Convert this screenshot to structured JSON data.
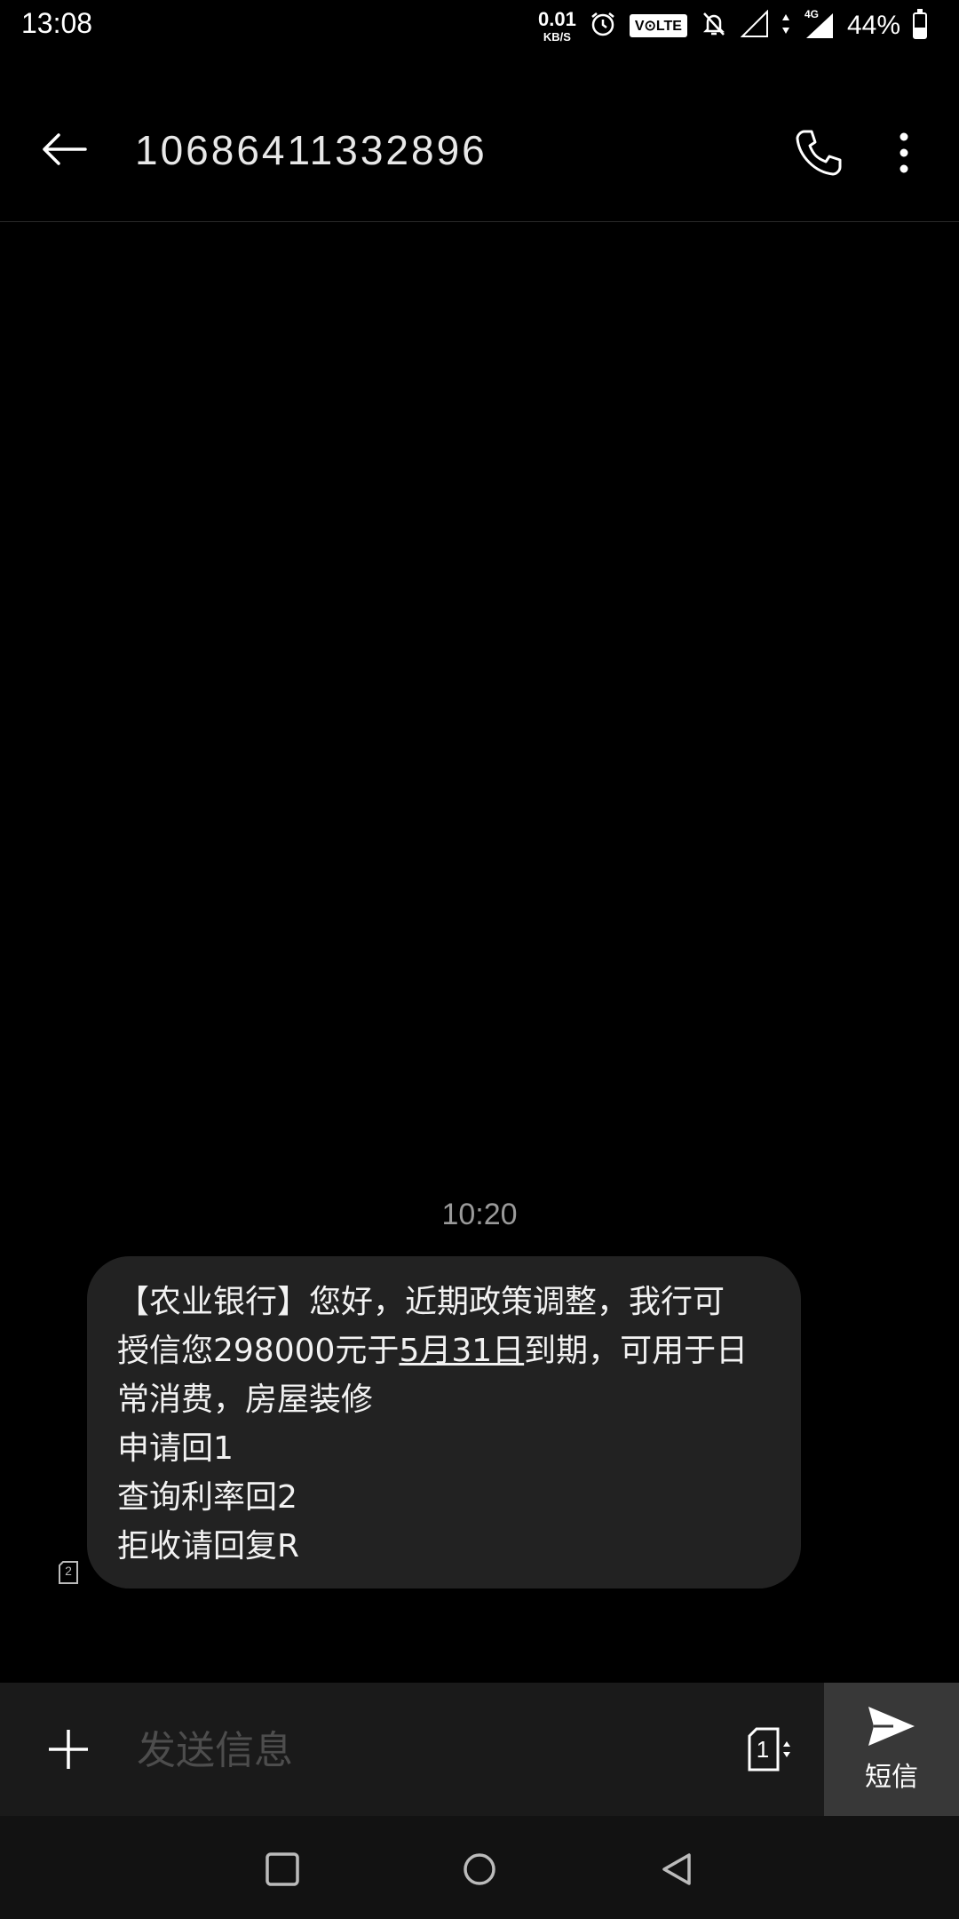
{
  "status_bar": {
    "time": "13:08",
    "net_speed_value": "0.01",
    "net_speed_unit": "KB/S",
    "volte_label": "V⊙LTE",
    "network_type": "4G",
    "battery_percent": "44%",
    "battery_level": 0.44
  },
  "header": {
    "title": "10686411332896"
  },
  "conversation": {
    "timestamp": "10:20",
    "message": {
      "line1": "【农业银行】您好，近期政策调整，我行可",
      "line2_pre": "授信您298000元于",
      "line2_link": "5月31日",
      "line2_post": "到期，可用于日",
      "line3": "常消费，房屋装修",
      "line4": "申请回1",
      "line5": "查询利率回2",
      "line6": "拒收请回复R"
    },
    "sim_slot": "2"
  },
  "composer": {
    "placeholder": "发送信息",
    "sim_selected": "1",
    "send_label": "短信"
  },
  "colors": {
    "background": "#000000",
    "bubble": "#222222",
    "composer": "#1a1a1a",
    "send_button": "#383838",
    "timestamp": "#9a9a9a"
  }
}
